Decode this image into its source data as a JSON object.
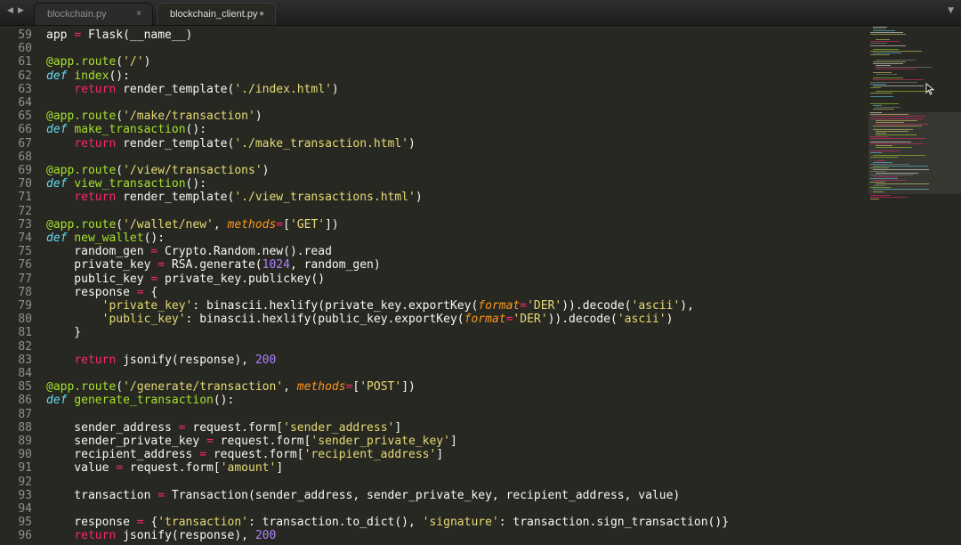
{
  "nav": {
    "back_icon": "arrow-left-icon",
    "forward_icon": "arrow-right-icon"
  },
  "tabs": [
    {
      "label": "blockchain.py",
      "active": false,
      "close_icon": "×"
    },
    {
      "label": "blockchain_client.py",
      "active": true,
      "dirty_icon": "●"
    }
  ],
  "tab_menu_icon": "▼",
  "colors": {
    "background": "#272822",
    "text": "#f8f8f2",
    "keyword": "#f92672",
    "definition": "#66d9ef",
    "function": "#a6e22e",
    "string": "#e6db74",
    "number": "#ae81ff",
    "parameter": "#fd971f",
    "line_number": "#8f908a"
  },
  "editor": {
    "lines": [
      {
        "n": "59",
        "tokens": [
          [
            "text",
            "app "
          ],
          [
            "kw",
            "="
          ],
          [
            "text",
            " Flask(__name__)"
          ]
        ]
      },
      {
        "n": "60",
        "tokens": []
      },
      {
        "n": "61",
        "tokens": [
          [
            "fn",
            "@app.route"
          ],
          [
            "text",
            "("
          ],
          [
            "str",
            "'/'"
          ],
          [
            "text",
            ")"
          ]
        ]
      },
      {
        "n": "62",
        "tokens": [
          [
            "def",
            "def"
          ],
          [
            "text",
            " "
          ],
          [
            "fn",
            "index"
          ],
          [
            "text",
            "():"
          ]
        ]
      },
      {
        "n": "63",
        "tokens": [
          [
            "text",
            "    "
          ],
          [
            "kw",
            "return"
          ],
          [
            "text",
            " render_template("
          ],
          [
            "str",
            "'./index.html'"
          ],
          [
            "text",
            ")"
          ]
        ]
      },
      {
        "n": "64",
        "tokens": []
      },
      {
        "n": "65",
        "tokens": [
          [
            "fn",
            "@app.route"
          ],
          [
            "text",
            "("
          ],
          [
            "str",
            "'/make/transaction'"
          ],
          [
            "text",
            ")"
          ]
        ]
      },
      {
        "n": "66",
        "tokens": [
          [
            "def",
            "def"
          ],
          [
            "text",
            " "
          ],
          [
            "fn",
            "make_transaction"
          ],
          [
            "text",
            "():"
          ]
        ]
      },
      {
        "n": "67",
        "tokens": [
          [
            "text",
            "    "
          ],
          [
            "kw",
            "return"
          ],
          [
            "text",
            " render_template("
          ],
          [
            "str",
            "'./make_transaction.html'"
          ],
          [
            "text",
            ")"
          ]
        ]
      },
      {
        "n": "68",
        "tokens": []
      },
      {
        "n": "69",
        "tokens": [
          [
            "fn",
            "@app.route"
          ],
          [
            "text",
            "("
          ],
          [
            "str",
            "'/view/transactions'"
          ],
          [
            "text",
            ")"
          ]
        ]
      },
      {
        "n": "70",
        "tokens": [
          [
            "def",
            "def"
          ],
          [
            "text",
            " "
          ],
          [
            "fn",
            "view_transaction"
          ],
          [
            "text",
            "():"
          ]
        ]
      },
      {
        "n": "71",
        "tokens": [
          [
            "text",
            "    "
          ],
          [
            "kw",
            "return"
          ],
          [
            "text",
            " render_template("
          ],
          [
            "str",
            "'./view_transactions.html'"
          ],
          [
            "text",
            ")"
          ]
        ]
      },
      {
        "n": "72",
        "tokens": []
      },
      {
        "n": "73",
        "tokens": [
          [
            "fn",
            "@app.route"
          ],
          [
            "text",
            "("
          ],
          [
            "str",
            "'/wallet/new'"
          ],
          [
            "text",
            ", "
          ],
          [
            "param",
            "methods"
          ],
          [
            "kw",
            "="
          ],
          [
            "text",
            "["
          ],
          [
            "str",
            "'GET'"
          ],
          [
            "text",
            "])"
          ]
        ]
      },
      {
        "n": "74",
        "tokens": [
          [
            "def",
            "def"
          ],
          [
            "text",
            " "
          ],
          [
            "fn",
            "new_wallet"
          ],
          [
            "text",
            "():"
          ]
        ]
      },
      {
        "n": "75",
        "tokens": [
          [
            "text",
            "    random_gen "
          ],
          [
            "kw",
            "="
          ],
          [
            "text",
            " Crypto.Random.new().read"
          ]
        ]
      },
      {
        "n": "76",
        "tokens": [
          [
            "text",
            "    private_key "
          ],
          [
            "kw",
            "="
          ],
          [
            "text",
            " RSA.generate("
          ],
          [
            "num",
            "1024"
          ],
          [
            "text",
            ", random_gen)"
          ]
        ]
      },
      {
        "n": "77",
        "tokens": [
          [
            "text",
            "    public_key "
          ],
          [
            "kw",
            "="
          ],
          [
            "text",
            " private_key.publickey()"
          ]
        ]
      },
      {
        "n": "78",
        "tokens": [
          [
            "text",
            "    response "
          ],
          [
            "kw",
            "="
          ],
          [
            "text",
            " {"
          ]
        ]
      },
      {
        "n": "79",
        "tokens": [
          [
            "text",
            "        "
          ],
          [
            "str",
            "'private_key'"
          ],
          [
            "text",
            ": binascii.hexlify(private_key.exportKey("
          ],
          [
            "param",
            "format"
          ],
          [
            "kw",
            "="
          ],
          [
            "str",
            "'DER'"
          ],
          [
            "text",
            ")).decode("
          ],
          [
            "str",
            "'ascii'"
          ],
          [
            "text",
            "),"
          ]
        ]
      },
      {
        "n": "80",
        "tokens": [
          [
            "text",
            "        "
          ],
          [
            "str",
            "'public_key'"
          ],
          [
            "text",
            ": binascii.hexlify(public_key.exportKey("
          ],
          [
            "param",
            "format"
          ],
          [
            "kw",
            "="
          ],
          [
            "str",
            "'DER'"
          ],
          [
            "text",
            ")).decode("
          ],
          [
            "str",
            "'ascii'"
          ],
          [
            "text",
            ")"
          ]
        ]
      },
      {
        "n": "81",
        "tokens": [
          [
            "text",
            "    }"
          ]
        ]
      },
      {
        "n": "82",
        "tokens": []
      },
      {
        "n": "83",
        "tokens": [
          [
            "text",
            "    "
          ],
          [
            "kw",
            "return"
          ],
          [
            "text",
            " jsonify(response), "
          ],
          [
            "num",
            "200"
          ]
        ]
      },
      {
        "n": "84",
        "tokens": []
      },
      {
        "n": "85",
        "tokens": [
          [
            "fn",
            "@app.route"
          ],
          [
            "text",
            "("
          ],
          [
            "str",
            "'/generate/transaction'"
          ],
          [
            "text",
            ", "
          ],
          [
            "param",
            "methods"
          ],
          [
            "kw",
            "="
          ],
          [
            "text",
            "["
          ],
          [
            "str",
            "'POST'"
          ],
          [
            "text",
            "])"
          ]
        ]
      },
      {
        "n": "86",
        "tokens": [
          [
            "def",
            "def"
          ],
          [
            "text",
            " "
          ],
          [
            "fn",
            "generate_transaction"
          ],
          [
            "text",
            "():"
          ]
        ]
      },
      {
        "n": "87",
        "tokens": []
      },
      {
        "n": "88",
        "tokens": [
          [
            "text",
            "    sender_address "
          ],
          [
            "kw",
            "="
          ],
          [
            "text",
            " request.form["
          ],
          [
            "str",
            "'sender_address'"
          ],
          [
            "text",
            "]"
          ]
        ]
      },
      {
        "n": "89",
        "tokens": [
          [
            "text",
            "    sender_private_key "
          ],
          [
            "kw",
            "="
          ],
          [
            "text",
            " request.form["
          ],
          [
            "str",
            "'sender_private_key'"
          ],
          [
            "text",
            "]"
          ]
        ]
      },
      {
        "n": "90",
        "tokens": [
          [
            "text",
            "    recipient_address "
          ],
          [
            "kw",
            "="
          ],
          [
            "text",
            " request.form["
          ],
          [
            "str",
            "'recipient_address'"
          ],
          [
            "text",
            "]"
          ]
        ]
      },
      {
        "n": "91",
        "tokens": [
          [
            "text",
            "    value "
          ],
          [
            "kw",
            "="
          ],
          [
            "text",
            " request.form["
          ],
          [
            "str",
            "'amount'"
          ],
          [
            "text",
            "]"
          ]
        ]
      },
      {
        "n": "92",
        "tokens": []
      },
      {
        "n": "93",
        "tokens": [
          [
            "text",
            "    transaction "
          ],
          [
            "kw",
            "="
          ],
          [
            "text",
            " Transaction(sender_address, sender_private_key, recipient_address, value)"
          ]
        ]
      },
      {
        "n": "94",
        "tokens": []
      },
      {
        "n": "95",
        "tokens": [
          [
            "text",
            "    response "
          ],
          [
            "kw",
            "="
          ],
          [
            "text",
            " {"
          ],
          [
            "str",
            "'transaction'"
          ],
          [
            "text",
            ": transaction.to_dict(), "
          ],
          [
            "str",
            "'signature'"
          ],
          [
            "text",
            ": transaction.sign_transaction()}"
          ]
        ]
      },
      {
        "n": "96",
        "tokens": [
          [
            "text",
            "    "
          ],
          [
            "kw",
            "return"
          ],
          [
            "text",
            " jsonify(response), "
          ],
          [
            "num",
            "200"
          ]
        ]
      }
    ]
  }
}
